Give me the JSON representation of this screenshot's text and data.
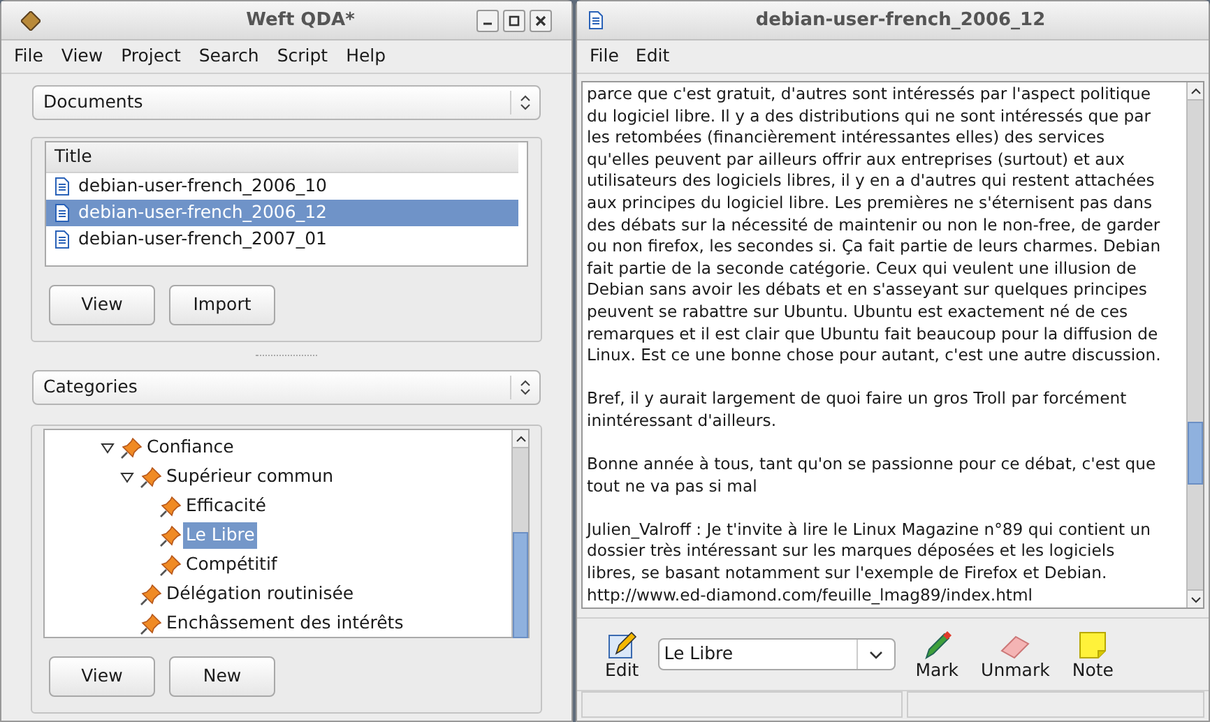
{
  "main_window": {
    "title": "Weft QDA*",
    "menu": [
      "File",
      "View",
      "Project",
      "Search",
      "Script",
      "Help"
    ],
    "documents_panel": {
      "selector": "Documents",
      "column": "Title",
      "rows": [
        {
          "title": "debian-user-french_2006_10",
          "selected": false
        },
        {
          "title": "debian-user-french_2006_12",
          "selected": true
        },
        {
          "title": "debian-user-french_2007_01",
          "selected": false
        }
      ],
      "buttons": [
        "View",
        "Import"
      ]
    },
    "categories_panel": {
      "selector": "Categories",
      "tree": [
        {
          "label": "Confiance",
          "selected": false,
          "expanded": true,
          "children": [
            {
              "label": "Supérieur commun",
              "selected": false,
              "expanded": true,
              "children": [
                {
                  "label": "Efficacité",
                  "selected": false
                },
                {
                  "label": "Le Libre",
                  "selected": true
                },
                {
                  "label": "Compétitif",
                  "selected": false
                }
              ]
            },
            {
              "label": "Délégation routinisée",
              "selected": false
            },
            {
              "label": "Enchâssement des intérêts",
              "selected": false
            }
          ]
        }
      ],
      "buttons": [
        "View",
        "New"
      ]
    }
  },
  "document_window": {
    "title": "debian-user-french_2006_12",
    "menu": [
      "File",
      "Edit"
    ],
    "paragraphs": [
      [
        "parce que c'est gratuit, d'autres sont intéressés par l'aspect politique",
        "du logiciel libre. Il y a des distributions qui ne sont intéressés que par",
        "les retombées (financièrement intéressantes elles) des services",
        "qu'elles peuvent par ailleurs offrir aux entreprises (surtout) et aux",
        "utilisateurs des logiciels libres, il y en a d'autres qui restent attachées",
        "aux principes du logiciel libre. Les premières ne s'éternisent pas dans",
        "des débats sur la nécessité de maintenir ou non le non-free, de garder",
        "ou non firefox, les secondes si. Ça fait partie de leurs charmes. Debian",
        "fait partie de la seconde catégorie. Ceux qui veulent une illusion de",
        "Debian sans avoir les débats et en s'asseyant sur quelques principes",
        "peuvent se rabattre sur Ubuntu. Ubuntu est exactement né de ces",
        "remarques et il est clair que Ubuntu fait beaucoup pour la diffusion de",
        "Linux. Est ce une bonne chose pour autant, c'est une autre discussion."
      ],
      [
        "Bref, il y aurait largement de quoi faire un gros Troll par forcément",
        "inintéressant d'ailleurs."
      ],
      [
        "Bonne année à tous, tant qu'on se passionne pour ce débat, c'est que",
        "tout ne va pas si mal"
      ],
      [
        "Julien_Valroff : Je t'invite à lire le Linux Magazine n°89 qui contient un",
        "dossier très intéressant sur les marques déposées et les logiciels",
        "libres, se basant notamment sur l'exemple de Firefox et Debian.",
        "http://www.ed-diamond.com/feuille_lmag89/index.html"
      ]
    ],
    "toolbar": [
      {
        "kind": "edit",
        "label": "Edit"
      },
      {
        "kind": "combo",
        "value": "Le Libre"
      },
      {
        "kind": "mark",
        "label": "Mark"
      },
      {
        "kind": "unmark",
        "label": "Unmark"
      },
      {
        "kind": "note",
        "label": "Note"
      }
    ]
  }
}
